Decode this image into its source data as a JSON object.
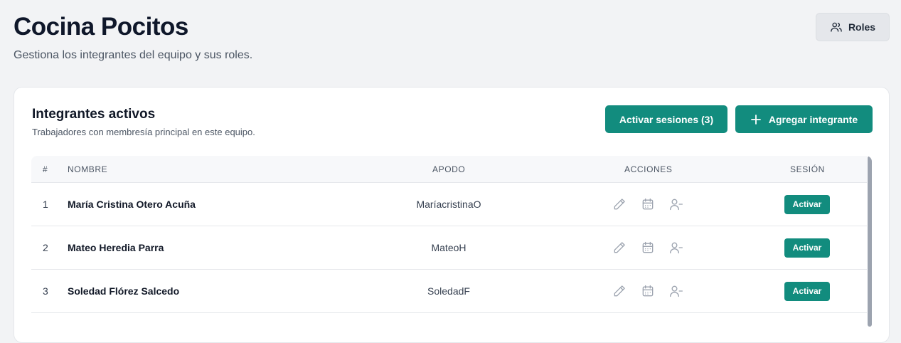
{
  "header": {
    "title": "Cocina Pocitos",
    "subtitle": "Gestiona los integrantes del equipo y sus roles.",
    "roles_label": "Roles"
  },
  "card": {
    "title": "Integrantes activos",
    "subtitle": "Trabajadores con membresía principal en este equipo.",
    "activate_sessions_label": "Activar sesiones (3)",
    "add_member_label": "Agregar integrante"
  },
  "table": {
    "columns": {
      "num": "#",
      "name": "NOMBRE",
      "nickname": "APODO",
      "actions": "ACCIONES",
      "session": "SESIÓN"
    },
    "rows": [
      {
        "num": "1",
        "name": "María Cristina Otero Acuña",
        "nickname": "MaríacristinaO",
        "session_label": "Activar"
      },
      {
        "num": "2",
        "name": "Mateo Heredia Parra",
        "nickname": "MateoH",
        "session_label": "Activar"
      },
      {
        "num": "3",
        "name": "Soledad Flórez Salcedo",
        "nickname": "SoledadF",
        "session_label": "Activar"
      }
    ]
  },
  "icons": {
    "roles": "users-icon",
    "add": "plus-icon",
    "edit": "pencil-icon",
    "schedule": "calendar-icon",
    "remove": "user-minus-icon"
  },
  "colors": {
    "accent": "#128c7e",
    "background": "#f2f3f5"
  }
}
